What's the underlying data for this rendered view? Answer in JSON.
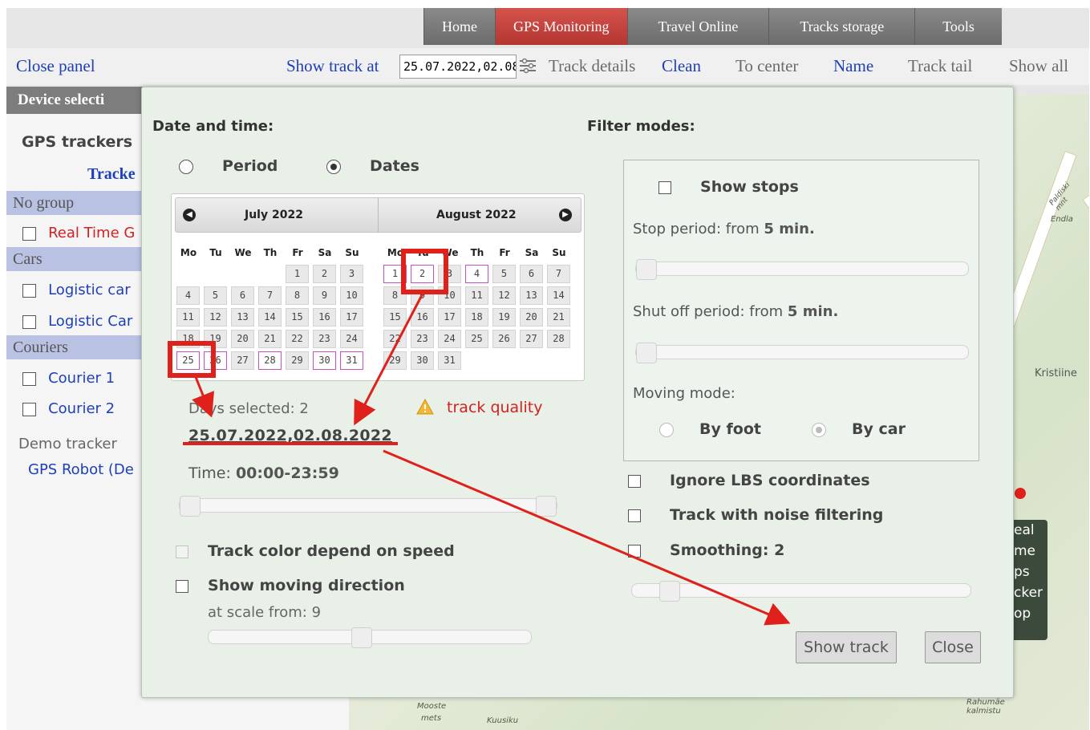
{
  "nav": {
    "tabs": [
      {
        "label": "Home"
      },
      {
        "label": "GPS Monitoring"
      },
      {
        "label": "Travel Online"
      },
      {
        "label": "Tracks storage"
      },
      {
        "label": "Tools"
      }
    ]
  },
  "toolbar": {
    "close_panel": "Close panel",
    "show_track_at": "Show track at",
    "date_value": "25.07.2022,02.08.2022",
    "track_details": "Track details",
    "clean": "Clean",
    "to_center": "To center",
    "name": "Name",
    "track_tail": "Track tail",
    "show_all": "Show all"
  },
  "left_panel": {
    "header": "Device selecti",
    "gps_trackers": "GPS trackers",
    "trackers_link": "Tracke",
    "groups": [
      {
        "name": "No group",
        "items": [
          "Real Time G"
        ]
      },
      {
        "name": "Cars",
        "items": [
          "Logistic car",
          "Logistic Car"
        ]
      },
      {
        "name": "Couriers",
        "items": [
          "Courier 1",
          "Courier 2"
        ]
      }
    ],
    "demo_tracker": "Demo tracker",
    "gps_robot": "GPS Robot (De"
  },
  "modal": {
    "date_time_label": "Date and time:",
    "period_label": "Period",
    "dates_label": "Dates",
    "filter_modes_label": "Filter modes:",
    "calendar": {
      "left_month": "July 2022",
      "right_month": "August 2022",
      "weekdays": [
        "Mo",
        "Tu",
        "We",
        "Th",
        "Fr",
        "Sa",
        "Su"
      ],
      "selected": [
        "25",
        "26",
        "28",
        "30",
        "31",
        "1",
        "2",
        "4"
      ]
    },
    "days_selected": "Days selected: 2",
    "track_quality": "track quality",
    "selected_dates": "25.07.2022,02.08.2022",
    "time_label": "Time:",
    "time_value": "00:00-23:59",
    "track_color_speed": "Track color depend on speed",
    "show_moving_direction": "Show moving direction",
    "at_scale_from": "at scale from: 9",
    "show_stops": "Show stops",
    "stop_period_prefix": "Stop period: from",
    "stop_period_value": "5 min.",
    "shutoff_prefix": "Shut off period: from",
    "shutoff_value": "5 min.",
    "moving_mode": "Moving mode:",
    "by_foot": "By foot",
    "by_car": "By car",
    "ignore_lbs": "Ignore LBS coordinates",
    "noise_filtering": "Track with noise filtering",
    "smoothing": "Smoothing: 2",
    "show_track_button": "Show track",
    "close_button": "Close"
  },
  "map": {
    "labels": [
      "Kristiine",
      "Endla",
      "Paldiski mnt",
      "Rahumäe kalmistu",
      "Kuusiku",
      "Mooste",
      "mets"
    ],
    "side_widget": [
      "eal",
      "me",
      "ps",
      "cker",
      "op"
    ]
  },
  "colors": {
    "accent_red": "#e0201b",
    "active_tab": "#c0403b",
    "link_blue": "#1d3fb8",
    "selected_day_border": "#c84ec8",
    "modal_bg": "#e8f0e8"
  }
}
